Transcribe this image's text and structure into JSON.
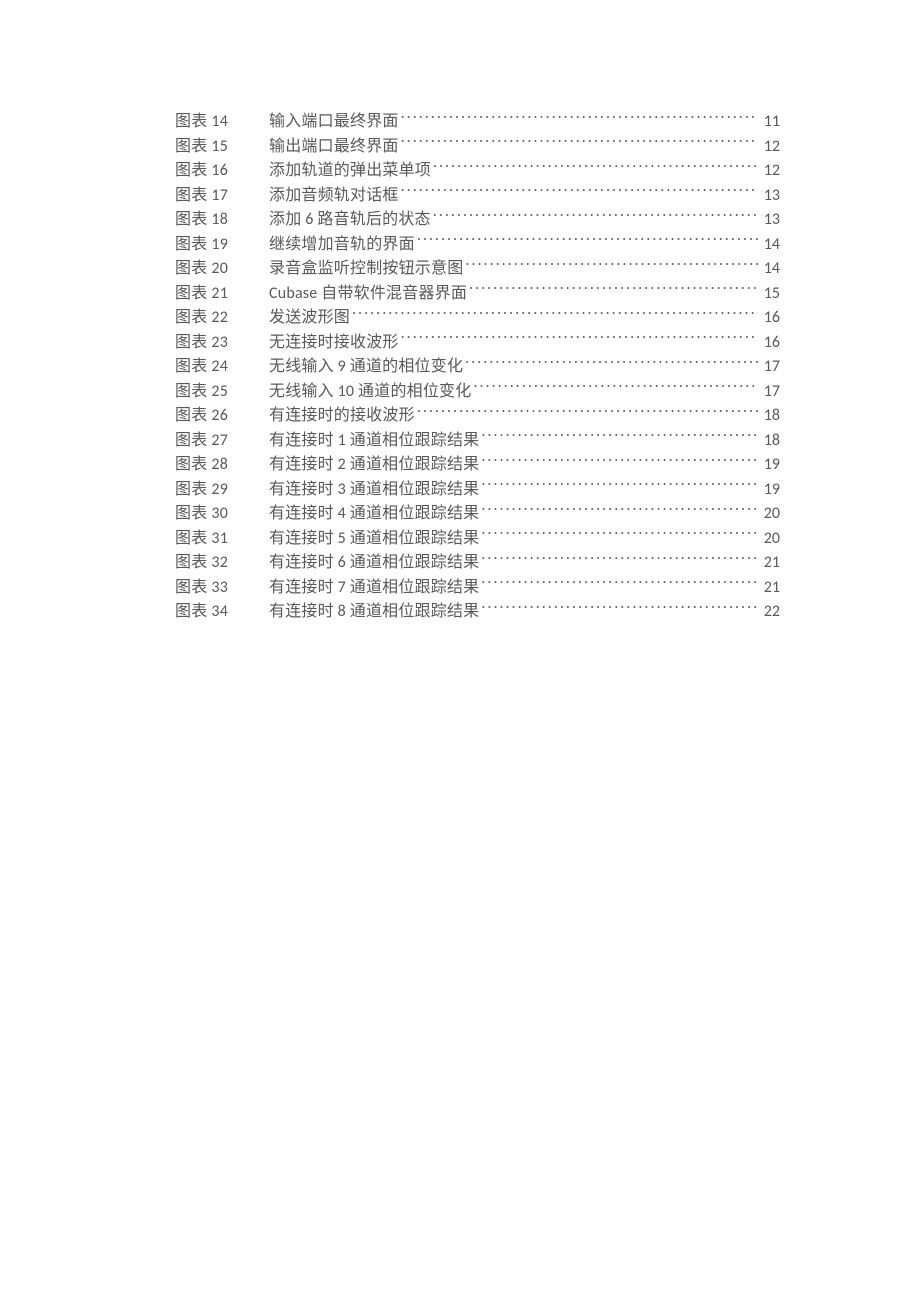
{
  "toc": {
    "labelPrefix": "图表",
    "entries": [
      {
        "n": "14",
        "title": "输入端口最终界面",
        "page": "11"
      },
      {
        "n": "15",
        "title": "输出端口最终界面",
        "page": "12"
      },
      {
        "n": "16",
        "title": "添加轨道的弹出菜单项",
        "page": "12"
      },
      {
        "n": "17",
        "title": "添加音频轨对话框",
        "page": "13"
      },
      {
        "n": "18",
        "title": "添加 6 路音轨后的状态",
        "page": "13"
      },
      {
        "n": "19",
        "title": "继续增加音轨的界面",
        "page": "14"
      },
      {
        "n": "20",
        "title": "录音盒监听控制按钮示意图",
        "page": "14"
      },
      {
        "n": "21",
        "title": "Cubase 自带软件混音器界面",
        "page": "15"
      },
      {
        "n": "22",
        "title": "发送波形图",
        "page": "16"
      },
      {
        "n": "23",
        "title": "无连接时接收波形",
        "page": "16"
      },
      {
        "n": "24",
        "title": "无线输入 9 通道的相位变化",
        "page": "17"
      },
      {
        "n": "25",
        "title": "无线输入 10 通道的相位变化",
        "page": "17"
      },
      {
        "n": "26",
        "title": "有连接时的接收波形",
        "page": "18"
      },
      {
        "n": "27",
        "title": "有连接时 1 通道相位跟踪结果",
        "page": "18"
      },
      {
        "n": "28",
        "title": "有连接时 2 通道相位跟踪结果",
        "page": "19"
      },
      {
        "n": "29",
        "title": "有连接时 3 通道相位跟踪结果",
        "page": "19"
      },
      {
        "n": "30",
        "title": "有连接时 4 通道相位跟踪结果",
        "page": "20"
      },
      {
        "n": "31",
        "title": "有连接时 5 通道相位跟踪结果",
        "page": "20"
      },
      {
        "n": "32",
        "title": "有连接时 6 通道相位跟踪结果",
        "page": "21"
      },
      {
        "n": "33",
        "title": "有连接时 7 通道相位跟踪结果",
        "page": "21"
      },
      {
        "n": "34",
        "title": "有连接时 8 通道相位跟踪结果",
        "page": "22"
      }
    ]
  }
}
